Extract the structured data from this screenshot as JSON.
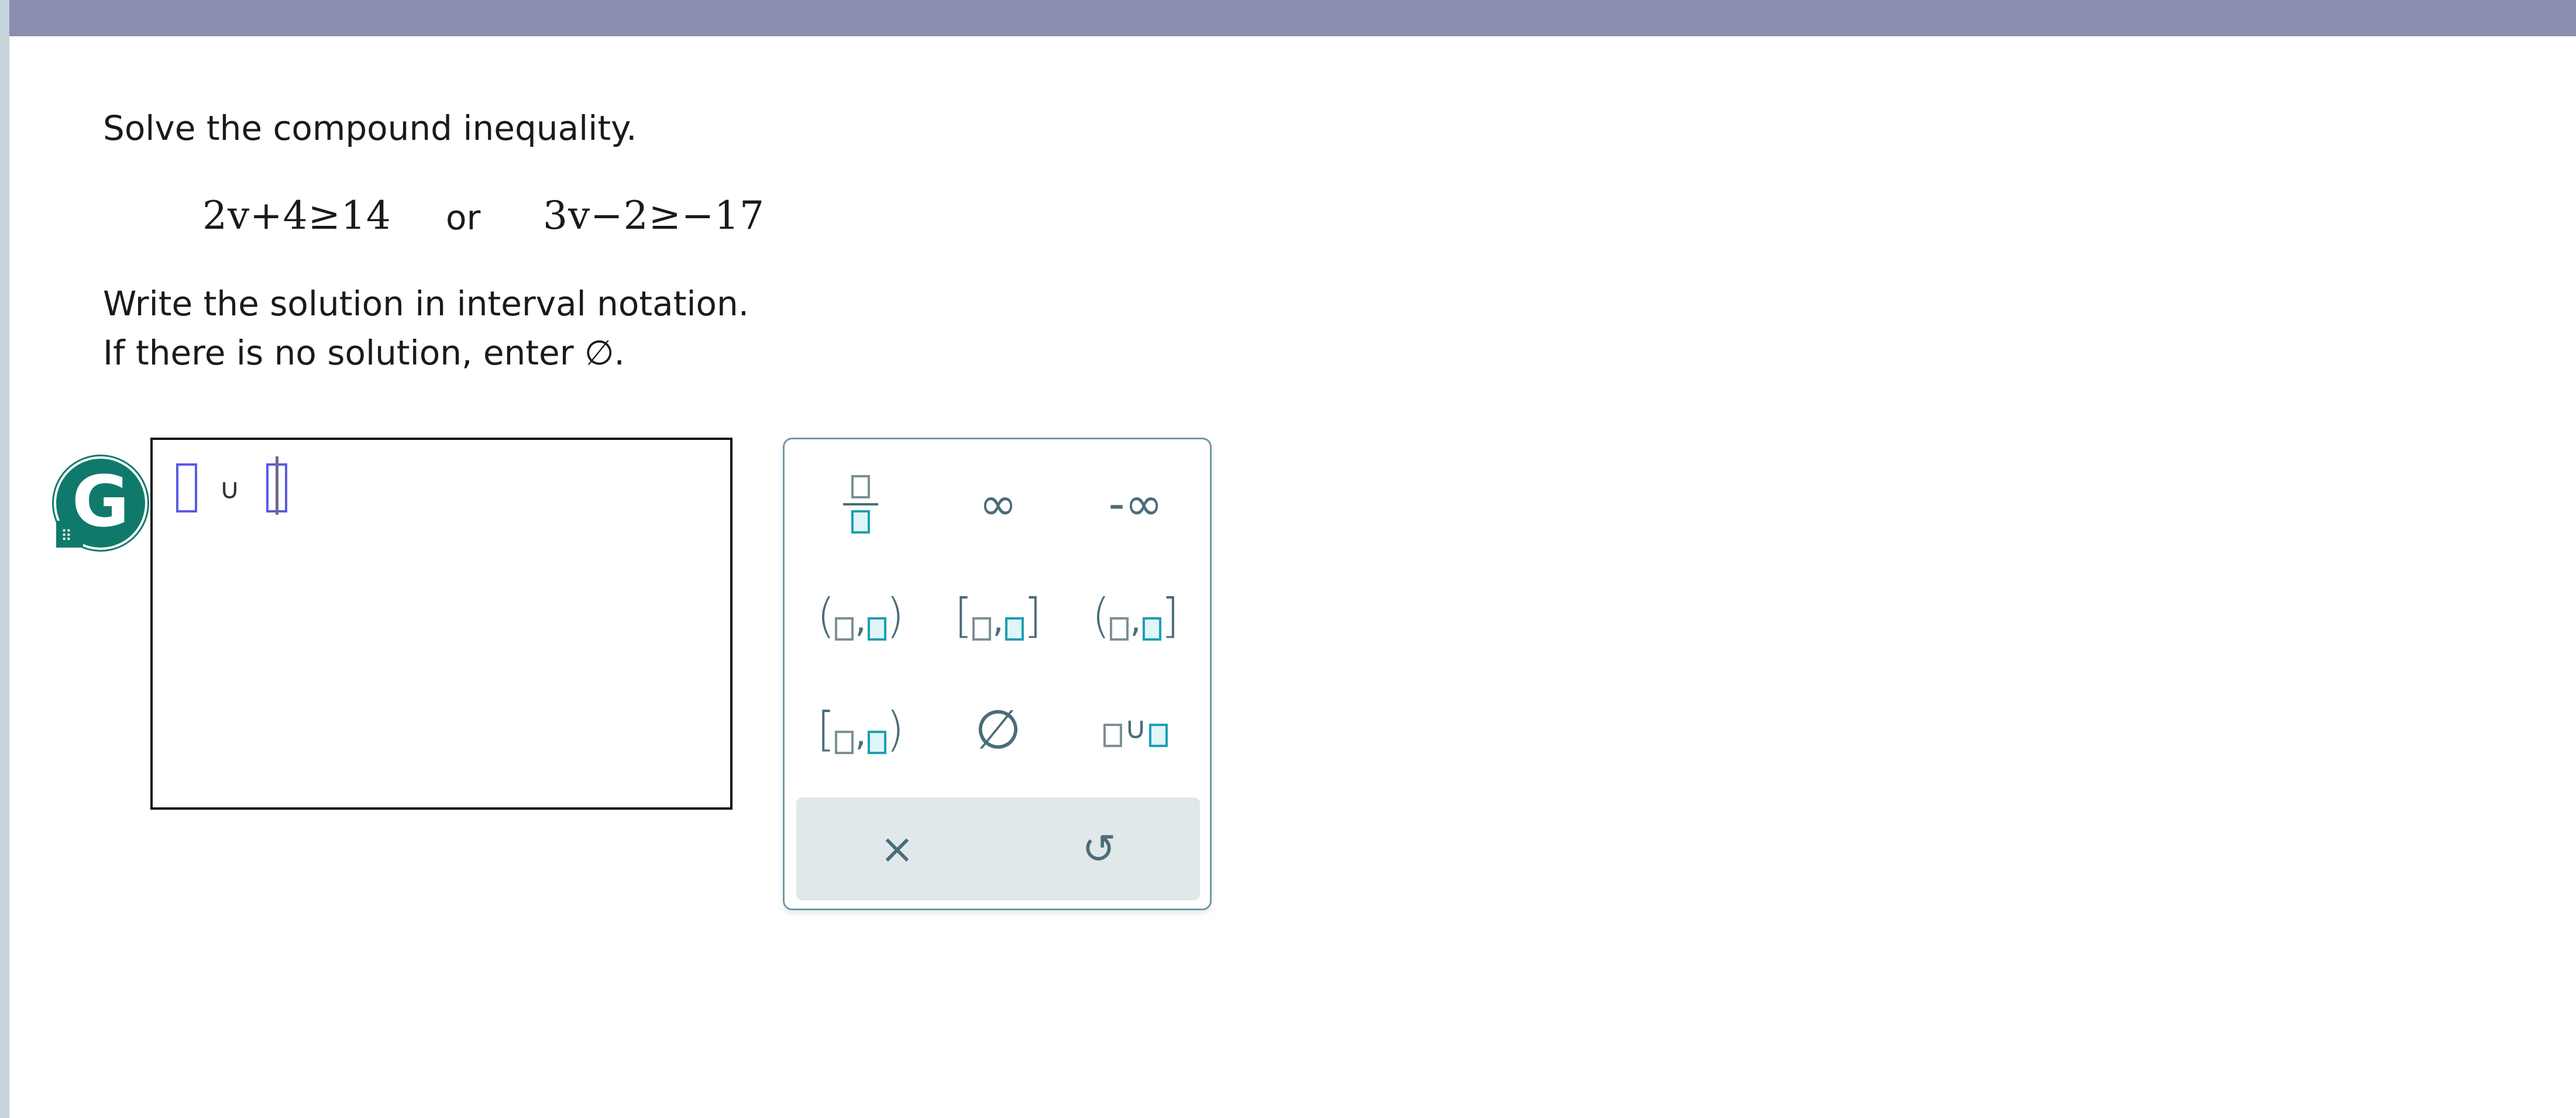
{
  "problem": {
    "prompt": "Solve the compound inequality.",
    "inequality_left": "2v+4≥14",
    "connector": "or",
    "inequality_right": "3v−2≥−17",
    "instruction_line1": "Write the solution in interval notation.",
    "instruction_line2": "If there is no solution, enter ∅."
  },
  "answer": {
    "union_symbol": "∪"
  },
  "badge": {
    "letter": "G",
    "color": "#0f7a6b"
  },
  "keypad": {
    "infinity": "∞",
    "neg_infinity": "-∞",
    "empty_set": "∅",
    "union": "∪",
    "clear": "×",
    "undo": "↺",
    "accent": "#1f9fb3",
    "icon_color": "#4a6d78"
  },
  "colors": {
    "top_bar": "#8b8daf",
    "left_strip": "#c5d3da"
  }
}
